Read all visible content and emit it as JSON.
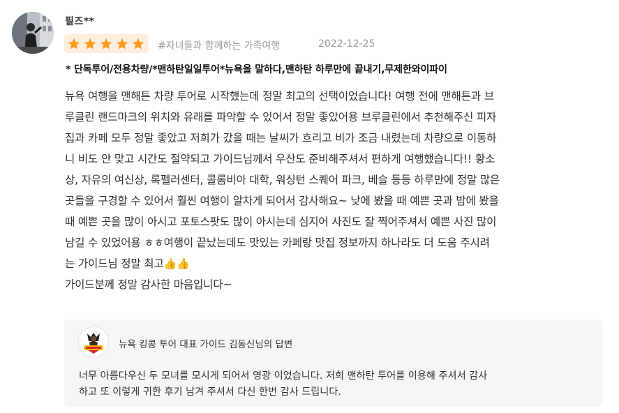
{
  "review": {
    "reviewer_name": "필즈**",
    "rating": 5,
    "rating_max": 5,
    "trip_type": "#자녀들과 함께하는 가족여행",
    "date": "2022-12-25",
    "product_name": "* 단독투어/전용차량/*맨하탄일일투어*뉴욕을 말하다,맨하탄 하루만에 끝내기,무제한와이파이",
    "body_lines": [
      "뉴욕 여행을 맨해튼 차량 투어로 시작했는데 정말 최고의 선택이었습니다! 여행 전에 맨해튼과 브",
      "루클린 랜드마크의 위치와 유래를 파악할 수 있어서 정말 좋았어용 브루클린에서 추천해주신 피자",
      "집과 카페 모두 정말 좋았고 저희가 갔을 때는 날씨가 흐리고 비가 조금 내렸는데 차량으로 이동하",
      "니 비도 안 맞고 시간도 절약되고 가이드님께서 우산도 준비해주셔서 편하게 여행했습니다!! 황소",
      "상, 자유의 여신상, 록펠러센터, 콜롬비아 대학, 워싱턴 스퀘어 파크, 베슬 등등 하루만에 정말 많은",
      "곳들을 구경할 수 있어서 훨씬 여행이 알차게 되어서 감사해요~ 낮에 봤을 때 예쁜 곳과 밤에 봤을",
      "때 예쁜 곳을 많이 아시고 포토스팟도 많이 아시는데 심지어 사진도 잘 찍어주셔서 예쁜 사진 많이",
      "남길 수 있었어용 ㅎㅎ여행이 끝났는데도 맛있는 카페랑 맛집 정보까지 하나라도 더 도움 주시려",
      "는 가이드님 정말 최고",
      "가이드분께 정말 감사한 마음입니다~"
    ],
    "thumbs_emoji": "👍👍"
  },
  "reply": {
    "guide_title": "뉴욕 킹콩 투어 대표 가이드 김동신님의 답변",
    "text_lines": [
      "너무 아름다우신 두 모녀를 모시게 되어서 영광 이었습니다. 저희 맨하탄 투어를 이용해 주셔서 감사",
      "하고 또 이렇게 귀한 후기 남겨 주셔서 다신 한번 감사 드립니다."
    ]
  },
  "colors": {
    "star": "#ff9a1a",
    "rating_badge_bg": "#fdeee0",
    "reply_bg": "#f6f6f6",
    "meta_text": "#999999"
  },
  "icons": {
    "reviewer_avatar": "user-photo-avatar",
    "star": "star-icon",
    "guide_avatar": "kingkong-tour-logo",
    "thumbs": "thumbs-up-icon"
  }
}
